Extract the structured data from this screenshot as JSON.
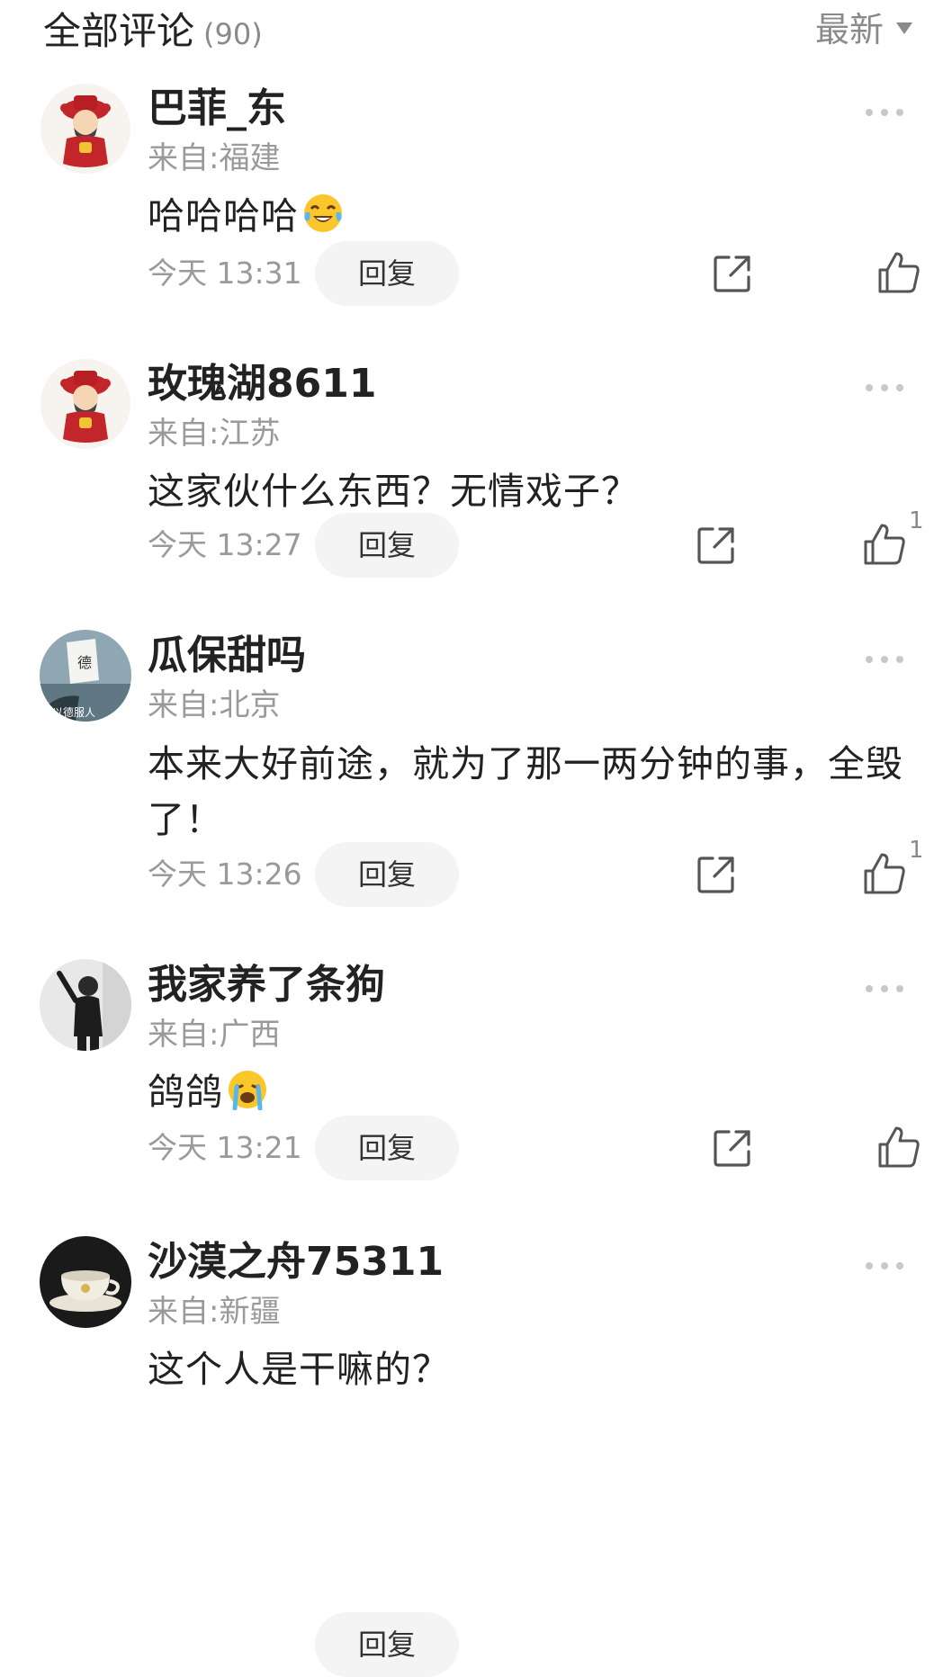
{
  "header": {
    "title": "全部评论",
    "count": "(90)",
    "sort_label": "最新"
  },
  "comments": [
    {
      "username": "巴菲_东",
      "location": "来自:福建",
      "text": "哈哈哈哈",
      "emoji": "laughing-tears-emoji",
      "time": "今天 13:31",
      "reply_label": "回复",
      "likes": ""
    },
    {
      "username": "玫瑰湖8611",
      "location": "来自:江苏",
      "text": "这家伙什么东西？无情戏子？",
      "time": "今天 13:27",
      "reply_label": "回复",
      "likes": "1"
    },
    {
      "username": "瓜保甜吗",
      "location": "来自:北京",
      "text": "本来大好前途，就为了那一两分钟的事，全毁了！",
      "time": "今天 13:26",
      "reply_label": "回复",
      "likes": "1"
    },
    {
      "username": "我家养了条狗",
      "location": "来自:广西",
      "text": "鸽鸽",
      "emoji": "crying-emoji",
      "time": "今天 13:21",
      "reply_label": "回复",
      "likes": ""
    },
    {
      "username": "沙漠之舟75311",
      "location": "来自:新疆",
      "text": "这个人是干嘛的？",
      "time": "",
      "reply_label": "回复",
      "likes": ""
    }
  ],
  "icons": {
    "more": "more-dots-icon",
    "share": "share-icon",
    "like": "thumbs-up-icon",
    "sort": "caret-down-icon"
  },
  "colors": {
    "text_primary": "#222222",
    "text_secondary": "#9a9a9a",
    "reply_bg": "#f4f4f4"
  }
}
